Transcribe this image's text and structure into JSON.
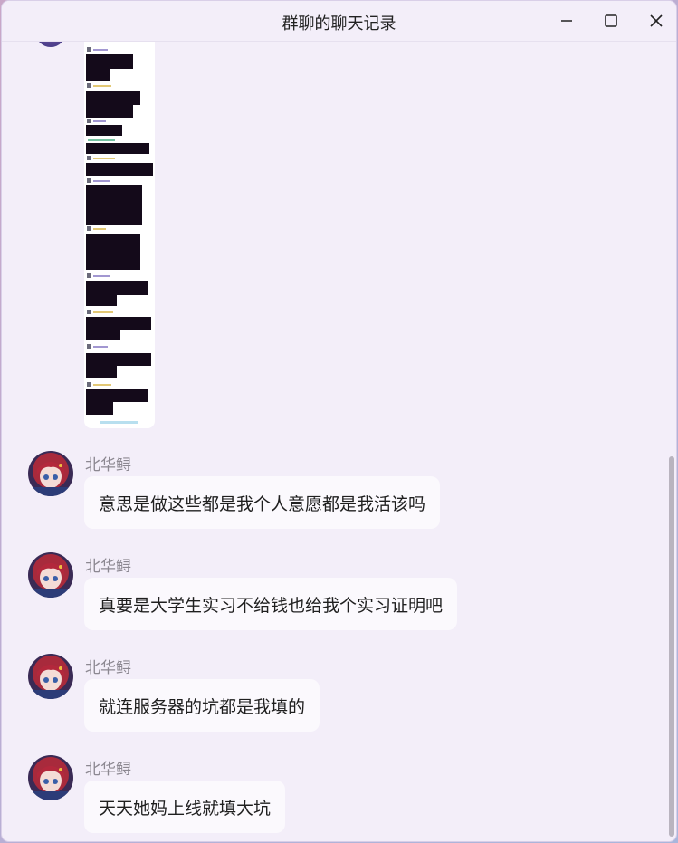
{
  "window": {
    "title": "群聊的聊天记录",
    "controls": {
      "minimize_icon": "minimize-icon",
      "maximize_icon": "maximize-icon",
      "close_icon": "close-icon"
    }
  },
  "messages": [
    {
      "sender": "北华鲟",
      "text": "意思是做这些都是我个人意愿都是我活该吗"
    },
    {
      "sender": "北华鲟",
      "text": "真要是大学生实习不给钱也给我个实习证明吧"
    },
    {
      "sender": "北华鲟",
      "text": "就连服务器的坑都是我填的"
    },
    {
      "sender": "北华鲟",
      "text": "天天她妈上线就填大坑"
    }
  ],
  "colors": {
    "window_bg": "#f3eef9",
    "bubble_bg": "#fbf9fd",
    "sender_text": "#8c8891",
    "message_text": "#1f1f1f"
  }
}
